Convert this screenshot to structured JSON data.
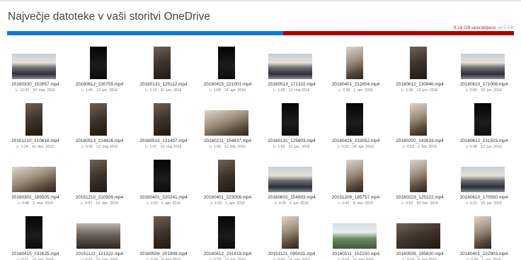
{
  "page": {
    "title": "Največje datoteke v vaši storitvi OneDrive",
    "storage_used": "9.16 GB uporabljeno",
    "storage_of": "od 5 GB",
    "used_fraction": 0.545
  },
  "colors": {
    "used_bar": "#0f78d4",
    "over_bar": "#a80000",
    "storage_text": "#c4262e"
  },
  "play_icon": "▷",
  "files": [
    {
      "name": "20160330_102657.mp4",
      "duration": "12:33",
      "date": "30. mar. 2016",
      "kind": "gym"
    },
    {
      "name": "20160612_230755.mp4",
      "duration": "1:40",
      "date": "12. jun. 2016",
      "kind": "dark-p"
    },
    {
      "name": "20160131_125112.mp4",
      "duration": "2:13",
      "date": "31. jan. 2016",
      "kind": "room-p"
    },
    {
      "name": "20160415_221001.mp4",
      "duration": "1:09",
      "date": "15. apr. 2016",
      "kind": "dark-p"
    },
    {
      "name": "20160513_171322.mp4",
      "duration": "1:05",
      "date": "13. maj 2016",
      "kind": "gym"
    },
    {
      "name": "20160401_212654.mp4",
      "duration": "2:28",
      "date": "1. apr. 2016",
      "kind": "light-p"
    },
    {
      "name": "20160612_230946.mp4",
      "duration": "1:30",
      "date": "12. jun. 2016",
      "kind": "room-p"
    },
    {
      "name": "20160610_171006.mp4",
      "duration": "0:55",
      "date": "10. jun. 2016",
      "kind": "gym"
    },
    {
      "name": "20151210_210618.mp4",
      "duration": "1:24",
      "date": "10. dec. 2015",
      "kind": "room-p"
    },
    {
      "name": "20160513_214426.mp4",
      "duration": "0:43",
      "date": "13. maj 2016",
      "kind": "room-p"
    },
    {
      "name": "20160515_131407.mp4",
      "duration": "1:07",
      "date": "15. maj 2016",
      "kind": "room-p"
    },
    {
      "name": "20160211_154837.mp4",
      "duration": "1:06",
      "date": "11. feb. 2016",
      "kind": "light"
    },
    {
      "name": "20160131_125603.mp4",
      "duration": "1:03",
      "date": "31. jan. 2016",
      "kind": "dark-p"
    },
    {
      "name": "20160426_233552.mp4",
      "duration": "0:32",
      "date": "26. apr. 2016",
      "kind": "dark-p"
    },
    {
      "name": "20160202_142619.mp4",
      "duration": "0:53",
      "date": "2. feb. 2016",
      "kind": "light-p"
    },
    {
      "name": "20160612_231503.mp4",
      "duration": "0:48",
      "date": "12. jun. 2016",
      "kind": "dark-p"
    },
    {
      "name": "20160302_185505.mp4",
      "duration": "0:48",
      "date": "2. mar. 2016",
      "kind": "light"
    },
    {
      "name": "20151210_210509.mp4",
      "duration": "0:47",
      "date": "10. dec. 2015",
      "kind": "room-p"
    },
    {
      "name": "20160401_220241.mp4",
      "duration": "1:03",
      "date": "1. apr. 2016",
      "kind": "dark-p"
    },
    {
      "name": "20160401_223056.mp4",
      "duration": "1:02",
      "date": "1. apr. 2016",
      "kind": "room-p"
    },
    {
      "name": "20160602_154903.mp4",
      "duration": "0:26",
      "date": "2. jun. 2016",
      "kind": "gym"
    },
    {
      "name": "20151208_185757.mp4",
      "duration": "0:42",
      "date": "8. dec. 2015",
      "kind": "light-p"
    },
    {
      "name": "20160223_125222.mp4",
      "duration": "0:53",
      "date": "23. feb. 2016",
      "kind": "light-p"
    },
    {
      "name": "20160610_170550.mp4",
      "duration": "0:21",
      "date": "10. jun. 2016",
      "kind": "gym"
    },
    {
      "name": "20160415_232625.mp4",
      "duration": "0:21",
      "date": "15. apr. 2016",
      "kind": "dark-p"
    },
    {
      "name": "20151122_121322.mp4",
      "duration": "0:33",
      "date": "22. nov. 2015",
      "kind": "rock"
    },
    {
      "name": "20160508_201909.mp4",
      "duration": "0:29",
      "date": "8. maj 2016",
      "kind": "room-p"
    },
    {
      "name": "20160612_231619.mp4",
      "duration": "0:33",
      "date": "12. jun. 2016",
      "kind": "dark-p"
    },
    {
      "name": "20151121_095031.mp4",
      "duration": "0:30",
      "date": "21. nov. 2015",
      "kind": "light-p"
    },
    {
      "name": "20160511_152150.mp4",
      "duration": "0:18",
      "date": "11. maj 2016",
      "kind": "outdoor"
    },
    {
      "name": "20160508_195820.mp4",
      "duration": "0:18",
      "date": "8. maj 2016",
      "kind": "room"
    },
    {
      "name": "20160401_222903.mp4",
      "duration": "0:39",
      "date": "1. apr. 2016",
      "kind": "light-p"
    }
  ]
}
